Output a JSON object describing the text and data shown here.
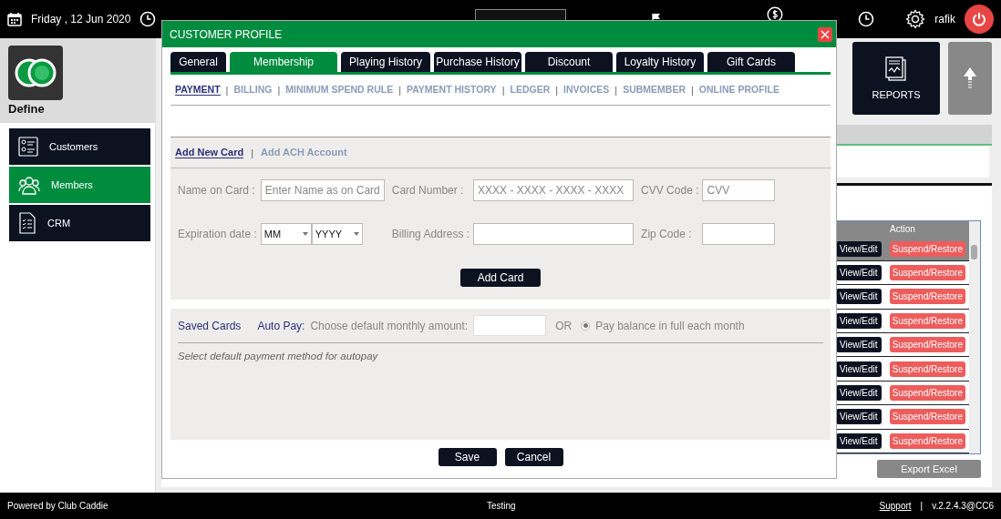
{
  "top_bar": {
    "date": "Friday ,  12 Jun 2020",
    "user": "rafik"
  },
  "sidebar": {
    "title": "Define",
    "items": [
      {
        "label": "Customers",
        "selected": false
      },
      {
        "label": "Members",
        "selected": true
      },
      {
        "label": "CRM",
        "selected": false
      }
    ]
  },
  "tiles": {
    "reports": "REPORTS"
  },
  "members_table": {
    "columns": [
      "Action"
    ],
    "rows": [
      {
        "view": "View/Edit",
        "suspend": "Suspend/Restore",
        "selected": true
      },
      {
        "view": "View/Edit",
        "suspend": "Suspend/Restore",
        "selected": false
      },
      {
        "view": "View/Edit",
        "suspend": "Suspend/Restore",
        "selected": false
      },
      {
        "view": "View/Edit",
        "suspend": "Suspend/Restore",
        "selected": false
      },
      {
        "view": "View/Edit",
        "suspend": "Suspend/Restore",
        "selected": false
      },
      {
        "view": "View/Edit",
        "suspend": "Suspend/Restore",
        "selected": false
      },
      {
        "view": "View/Edit",
        "suspend": "Suspend/Restore",
        "selected": false
      },
      {
        "view": "View/Edit",
        "suspend": "Suspend/Restore",
        "selected": false
      },
      {
        "view": "View/Edit",
        "suspend": "Suspend/Restore",
        "selected": false
      }
    ],
    "export_button": "Export Excel"
  },
  "dialog": {
    "title": "CUSTOMER PROFILE",
    "tabs": [
      {
        "label": "General",
        "selected": false
      },
      {
        "label": "Membership",
        "selected": true
      },
      {
        "label": "Playing History",
        "selected": false
      },
      {
        "label": "Purchase History",
        "selected": false
      },
      {
        "label": "Discount",
        "selected": false
      },
      {
        "label": "Loyalty History",
        "selected": false
      },
      {
        "label": "Gift Cards",
        "selected": false
      }
    ],
    "subtabs": {
      "separator": "|",
      "items": [
        {
          "label": "PAYMENT",
          "selected": true
        },
        {
          "label": "BILLING",
          "selected": false
        },
        {
          "label": "MINIMUM SPEND RULE",
          "selected": false
        },
        {
          "label": "PAYMENT HISTORY",
          "selected": false
        },
        {
          "label": "LEDGER",
          "selected": false
        },
        {
          "label": "INVOICES",
          "selected": false
        },
        {
          "label": "SUBMEMBER",
          "selected": false
        },
        {
          "label": "ONLINE PROFILE",
          "selected": false
        }
      ]
    },
    "card_tabs": {
      "separator": "|",
      "items": [
        {
          "label": "Add New Card",
          "selected": true
        },
        {
          "label": "Add ACH Account",
          "selected": false
        }
      ]
    },
    "card_form": {
      "name_on_card": {
        "label": "Name on Card :",
        "placeholder": "Enter Name as on Card"
      },
      "card_number": {
        "label": "Card Number :",
        "placeholder": "XXXX - XXXX - XXXX - XXXX"
      },
      "cvv": {
        "label": "CVV Code :",
        "placeholder": "CVV"
      },
      "expiration": {
        "label": "Expiration date :",
        "month": "MM",
        "year": "YYYY"
      },
      "billing_address": {
        "label": "Billing Address :"
      },
      "zip_code": {
        "label": "Zip Code :"
      },
      "add_button": "Add Card"
    },
    "saved_cards": {
      "title": "Saved Cards",
      "auto_pay_label": "Auto Pay:",
      "amount_label": "Choose default monthly amount:",
      "or": "OR",
      "pay_full": {
        "label": "Pay balance in full each month",
        "selected": true
      },
      "hint": "Select default payment method for autopay"
    },
    "buttons": [
      "Save",
      "Cancel"
    ]
  },
  "footer": {
    "powered_by": "Powered by Club Caddie",
    "environment": "Testing",
    "support_link": "Support",
    "separator": "|",
    "version": "v.2.2.4.3@CC6"
  }
}
